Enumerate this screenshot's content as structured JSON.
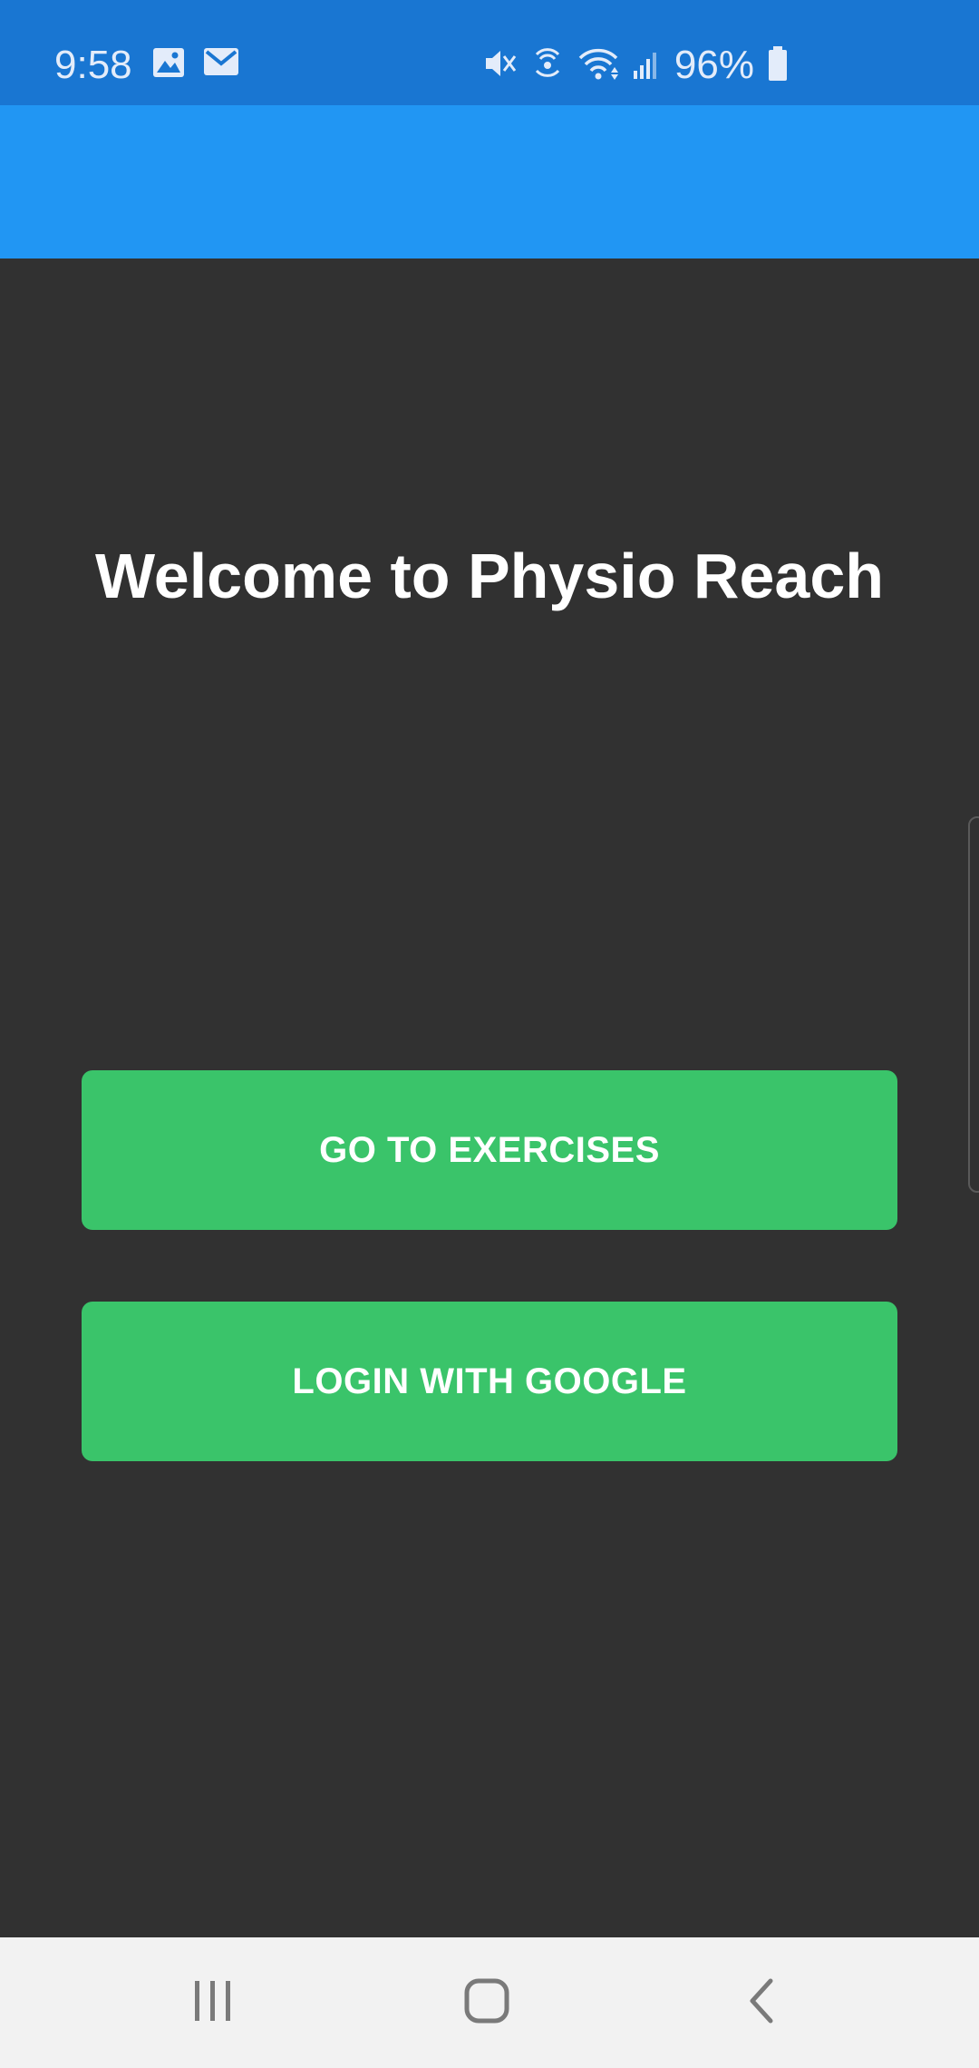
{
  "status_bar": {
    "time": "9:58",
    "battery_percent": "96%",
    "left_icons": [
      "image-icon",
      "mail-icon"
    ],
    "right_icons": [
      "mute-icon",
      "hotspot-icon",
      "wifi-icon",
      "signal-icon",
      "battery-icon"
    ]
  },
  "main": {
    "welcome_title": "Welcome to Physio Reach",
    "go_to_exercises_label": "GO TO EXERCISES",
    "login_google_label": "LOGIN WITH GOOGLE"
  },
  "nav_bar": {
    "icons": [
      "recents-icon",
      "home-icon",
      "back-icon"
    ]
  },
  "colors": {
    "status_bar": "#1976d2",
    "app_bar": "#2196f3",
    "background": "#313131",
    "button": "#3ac46a",
    "nav_bar": "#f2f2f2"
  }
}
